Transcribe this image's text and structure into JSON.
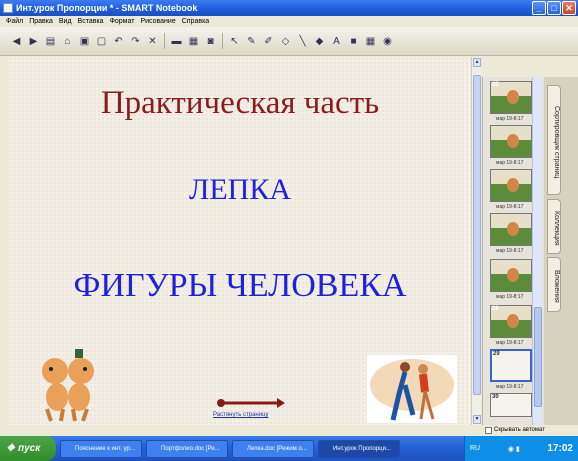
{
  "window": {
    "title": "Инт.урок Пропорции * - SMART Notebook",
    "controls": {
      "minimize": "_",
      "maximize": "□",
      "close": "✕"
    }
  },
  "menu": [
    "Файл",
    "Правка",
    "Вид",
    "Вставка",
    "Формат",
    "Рисование",
    "Справка"
  ],
  "toolbar": {
    "icons": [
      "back-icon",
      "forward-icon",
      "add-page-icon",
      "open-icon",
      "save-icon",
      "paste-icon",
      "undo-icon",
      "redo-icon",
      "delete-icon",
      "screen-shade-icon",
      "full-screen-icon",
      "capture-icon",
      "select-icon",
      "pen-icon",
      "creative-pen-icon",
      "eraser-icon",
      "line-icon",
      "fill-icon",
      "text-icon",
      "shapes-icon",
      "table-icon",
      "properties-icon"
    ]
  },
  "slide": {
    "title": "Практическая часть",
    "line2": "ЛЕПКА",
    "line3": "ФИГУРЫ ЧЕЛОВЕКА",
    "link": "Растянуть страницу"
  },
  "sorter": {
    "thumbs": [
      {
        "num": "25",
        "label": "мар 19-8:17"
      },
      {
        "num": "",
        "label": "мар 19-8:17"
      },
      {
        "num": "",
        "label": "мар 19-8:17"
      },
      {
        "num": "",
        "label": "мар 19-8:17"
      },
      {
        "num": "",
        "label": "мар 19-8:17"
      },
      {
        "num": "28",
        "label": "мар 19-8:17"
      },
      {
        "num": "29",
        "label": "мар 19-8:17"
      },
      {
        "num": "30",
        "label": ""
      }
    ]
  },
  "sidetabs": [
    "Сортировщик страниц",
    "Коллекция",
    "Вложения"
  ],
  "hide_auto_label": "Скрывать автомат",
  "taskbar": {
    "start": "пуск",
    "tasks": [
      "Пояснение к инт. ур...",
      "Портфолио.doc [Ре...",
      "Лепка.doc [Режим о...",
      "Инт.урок Пропорци..."
    ],
    "lang": "RU",
    "time": "17:02"
  },
  "colors": {
    "title": "#8a1c1c",
    "text": "#1e22e0",
    "taskbar": "#245fd4"
  }
}
